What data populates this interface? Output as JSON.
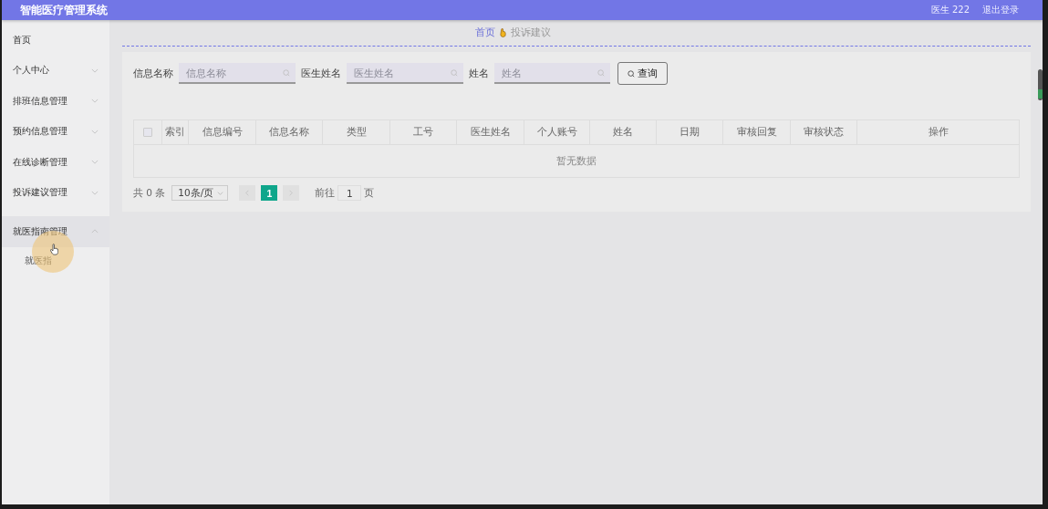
{
  "header": {
    "title": "智能医疗管理系统",
    "user": "医生 222",
    "logout": "退出登录"
  },
  "sidebar": {
    "items": [
      {
        "label": "首页"
      },
      {
        "label": "个人中心",
        "expanded": false
      },
      {
        "label": "排班信息管理",
        "expanded": false
      },
      {
        "label": "预约信息管理",
        "expanded": false
      },
      {
        "label": "在线诊断管理",
        "expanded": false
      },
      {
        "label": "投诉建议管理",
        "expanded": false
      },
      {
        "label": "就医指南管理",
        "expanded": true,
        "children": [
          {
            "label": "就医指"
          }
        ]
      }
    ]
  },
  "breadcrumb": [
    {
      "label": "首页",
      "kind": "link"
    },
    {
      "label": "投诉建议",
      "kind": "current"
    }
  ],
  "search": {
    "fields": [
      {
        "label": "信息名称",
        "placeholder": "信息名称"
      },
      {
        "label": "医生姓名",
        "placeholder": "医生姓名"
      },
      {
        "label": "姓名",
        "placeholder": "姓名"
      }
    ],
    "button": "查询"
  },
  "table": {
    "columns": [
      "索引",
      "信息编号",
      "信息名称",
      "类型",
      "工号",
      "医生姓名",
      "个人账号",
      "姓名",
      "日期",
      "审核回复",
      "审核状态",
      "操作"
    ],
    "empty_text": "暂无数据",
    "select_all": {
      "checked": false
    }
  },
  "pagination": {
    "total": "共 0 条",
    "page_size": "10条/页",
    "pages": [
      {
        "label": "1",
        "selected": true
      }
    ],
    "goto_label": "前往",
    "goto_value": "1",
    "page_unit": "页"
  }
}
